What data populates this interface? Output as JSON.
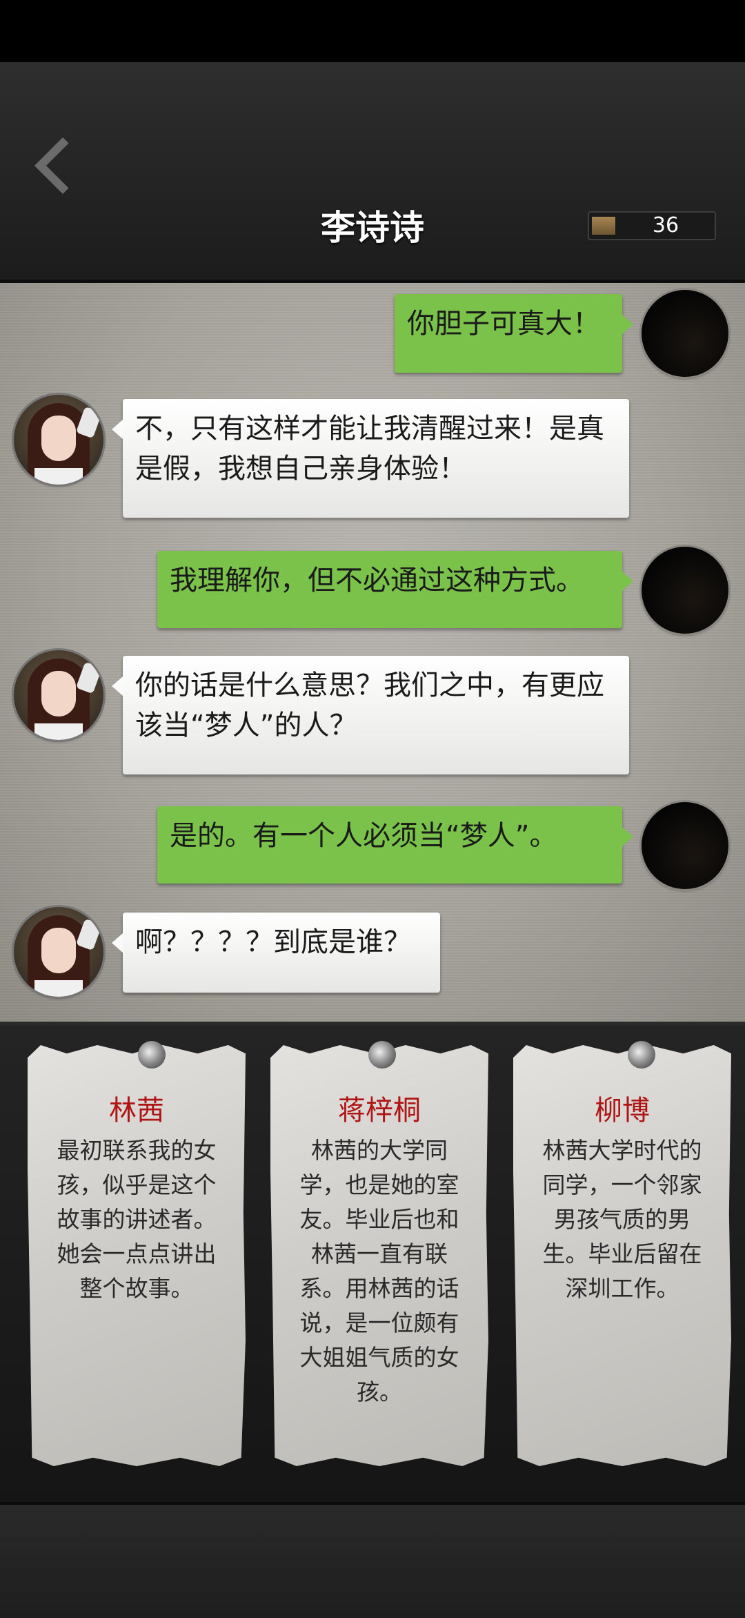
{
  "header": {
    "title": "李诗诗",
    "counter": "36"
  },
  "messages": [
    {
      "side": "right",
      "text": "你胆子可真大！"
    },
    {
      "side": "left",
      "text": "不，只有这样才能让我清醒过来！是真是假，我想自己亲身体验！"
    },
    {
      "side": "right",
      "text": "我理解你，但不必通过这种方式。"
    },
    {
      "side": "left",
      "text": "你的话是什么意思？我们之中，有更应该当“梦人”的人？"
    },
    {
      "side": "right",
      "text": "是的。有一个人必须当“梦人”。"
    },
    {
      "side": "left",
      "text": "啊？？？？到底是谁？"
    }
  ],
  "characters": [
    {
      "name": "林茜",
      "desc": "最初联系我的女孩，似乎是这个故事的讲述者。她会一点点讲出整个故事。"
    },
    {
      "name": "蒋梓桐",
      "desc": "林茜的大学同学，也是她的室友。毕业后也和林茜一直有联系。用林茜的话说，是一位颇有大姐姐气质的女孩。"
    },
    {
      "name": "柳博",
      "desc": "林茜大学时代的同学，一个邻家男孩气质的男生。毕业后留在深圳工作。"
    }
  ],
  "colors": {
    "accent_name": "#b01515",
    "bubble_right": "#7ac24a",
    "bubble_left": "#f5f5f3"
  }
}
